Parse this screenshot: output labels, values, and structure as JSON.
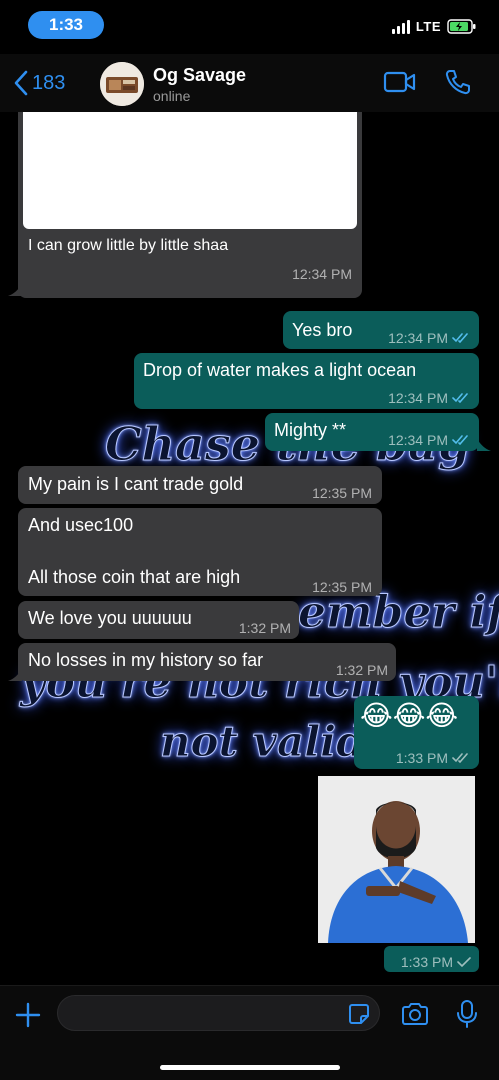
{
  "status": {
    "time": "1:33",
    "network": "LTE"
  },
  "header": {
    "back_count": "183",
    "contact_name": "Og Savage",
    "contact_status": "online"
  },
  "wallpaper": {
    "line1": "Chase the bag",
    "line2": "ember if",
    "line3": "you're not rich you're",
    "line4": "not valid"
  },
  "messages": [
    {
      "dir": "in",
      "text": "I can grow little by little shaa",
      "time": "12:34 PM"
    },
    {
      "dir": "out",
      "text": "Yes bro",
      "time": "12:34 PM"
    },
    {
      "dir": "out",
      "text": "Drop of water makes a light ocean",
      "time": "12:34 PM"
    },
    {
      "dir": "out",
      "text": "Mighty **",
      "time": "12:34 PM"
    },
    {
      "dir": "in",
      "text": "My pain is I cant trade gold",
      "time": "12:35 PM"
    },
    {
      "dir": "in",
      "text": "And usec100",
      "text2": "All those coin that are high",
      "time": "12:35 PM"
    },
    {
      "dir": "in",
      "text": "We love you uuuuuu",
      "time": "1:32 PM"
    },
    {
      "dir": "in",
      "text": "No losses in my history so far",
      "time": "1:32 PM"
    },
    {
      "dir": "out",
      "text": "😂😂😂",
      "time": "1:33 PM"
    },
    {
      "dir": "out",
      "text": "",
      "time": "1:33 PM"
    }
  ],
  "colors": {
    "accent": "#2f8ff0",
    "incoming_bubble": "#3a3a3c",
    "outgoing_bubble": "#0b5d5a",
    "read_tick": "#53bdeb"
  }
}
